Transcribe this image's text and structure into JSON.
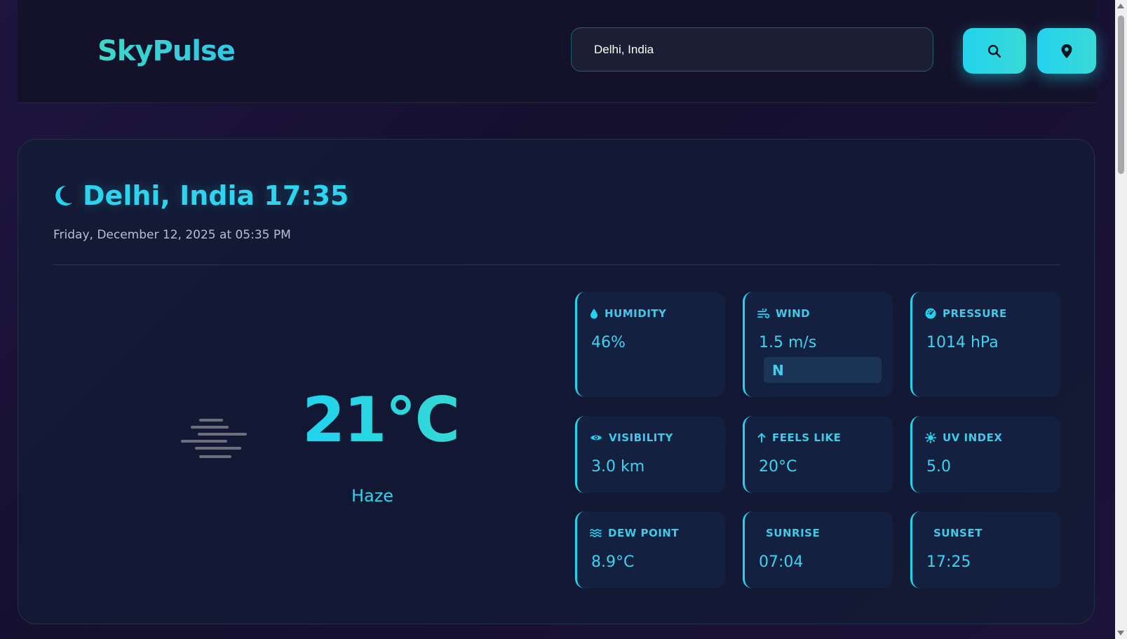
{
  "app": {
    "name": "SkyPulse"
  },
  "search": {
    "value": "Delhi, India"
  },
  "location": {
    "title": "Delhi, India 17:35",
    "datetime": "Friday, December 12, 2025 at 05:35 PM"
  },
  "current": {
    "temperature": "21°C",
    "condition": "Haze"
  },
  "stats": {
    "humidity": {
      "label": "HUMIDITY",
      "value": "46%"
    },
    "wind": {
      "label": "WIND",
      "value": "1.5 m/s",
      "direction": "N"
    },
    "pressure": {
      "label": "PRESSURE",
      "value": "1014 hPa"
    },
    "visibility": {
      "label": "VISIBILITY",
      "value": "3.0 km"
    },
    "feels_like": {
      "label": "FEELS LIKE",
      "value": "20°C"
    },
    "uv_index": {
      "label": "UV INDEX",
      "value": "5.0"
    },
    "dew_point": {
      "label": "DEW POINT",
      "value": "8.9°C"
    },
    "sunrise": {
      "label": "SUNRISE",
      "value": "07:04"
    },
    "sunset": {
      "label": "SUNSET",
      "value": "17:25"
    }
  },
  "colors": {
    "accent": "#22d3ee",
    "teal": "#3ed7c8",
    "card": "#142040"
  },
  "icons": [
    "search-icon",
    "location-pin-icon",
    "moon-icon",
    "haze-icon",
    "droplet-icon",
    "wind-icon",
    "gauge-icon",
    "eye-icon",
    "arrow-up-icon",
    "sun-icon",
    "waves-icon"
  ]
}
